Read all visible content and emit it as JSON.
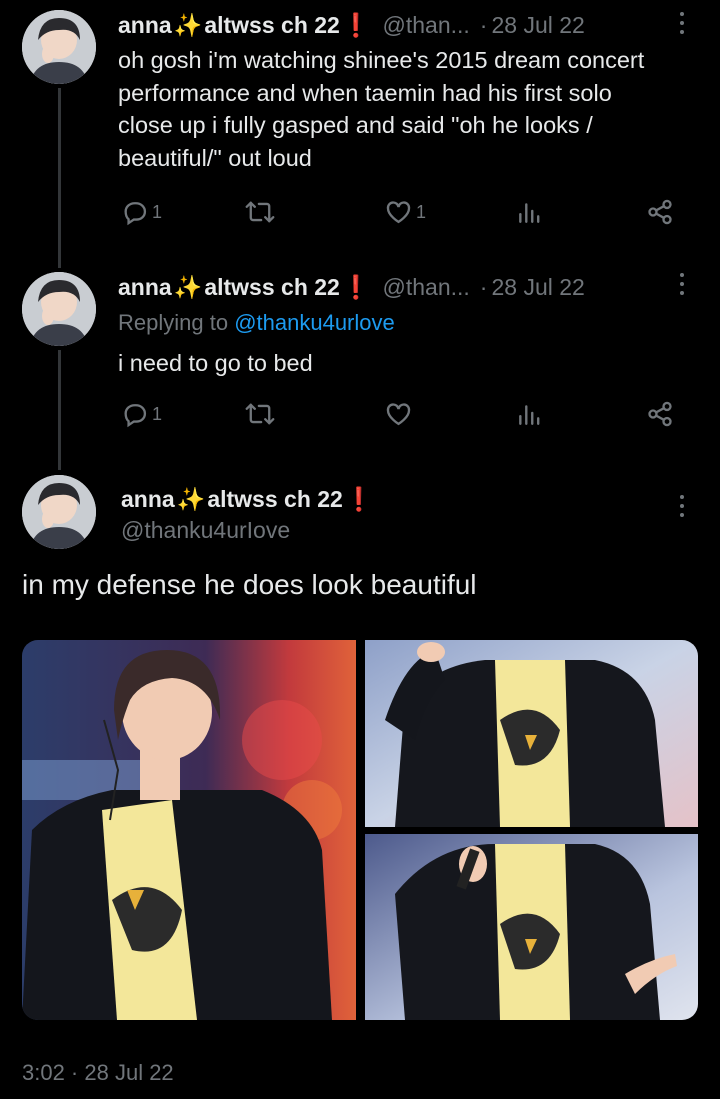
{
  "tweets": [
    {
      "display_name": "anna",
      "handle_suffix": "altwss ch 22",
      "handle": "@than...",
      "date": "28 Jul 22",
      "text": [
        "oh gosh i'm watching shinee's 2015 dream concert",
        "performance and when taemin had his first solo",
        "close up i fully gasped and said \"oh he looks /",
        "beautiful/\" out loud"
      ],
      "replies": "1",
      "retweets": "",
      "likes": "1"
    },
    {
      "display_name": "anna",
      "handle_suffix": "altwss ch 22",
      "handle": "@than...",
      "date": "28 Jul 22",
      "reply_prefix": "Replying to",
      "reply_target": "@thanku4urlove",
      "text": [
        "i need to go to bed"
      ],
      "replies": "1",
      "retweets": "",
      "likes": ""
    }
  ],
  "main": {
    "display_name": "anna",
    "handle_suffix": "altwss ch 22",
    "handle": "@thanku4urIove",
    "text": "in my defense he does look beautiful",
    "timestamp": "3:02 · 28 Jul 22"
  },
  "icons": {
    "reply": "reply-icon",
    "retweet": "retweet-icon",
    "like": "heart-icon",
    "views": "views-icon",
    "share": "share-icon",
    "more": "more-icon",
    "sparkles": "sparkles-emoji",
    "exclamation": "red-exclamation-emoji"
  },
  "colors": {
    "background": "#000000",
    "text": "#e7e9ea",
    "secondary": "#71767b",
    "link": "#1d9bf0",
    "exclamation": "#e0245e"
  }
}
